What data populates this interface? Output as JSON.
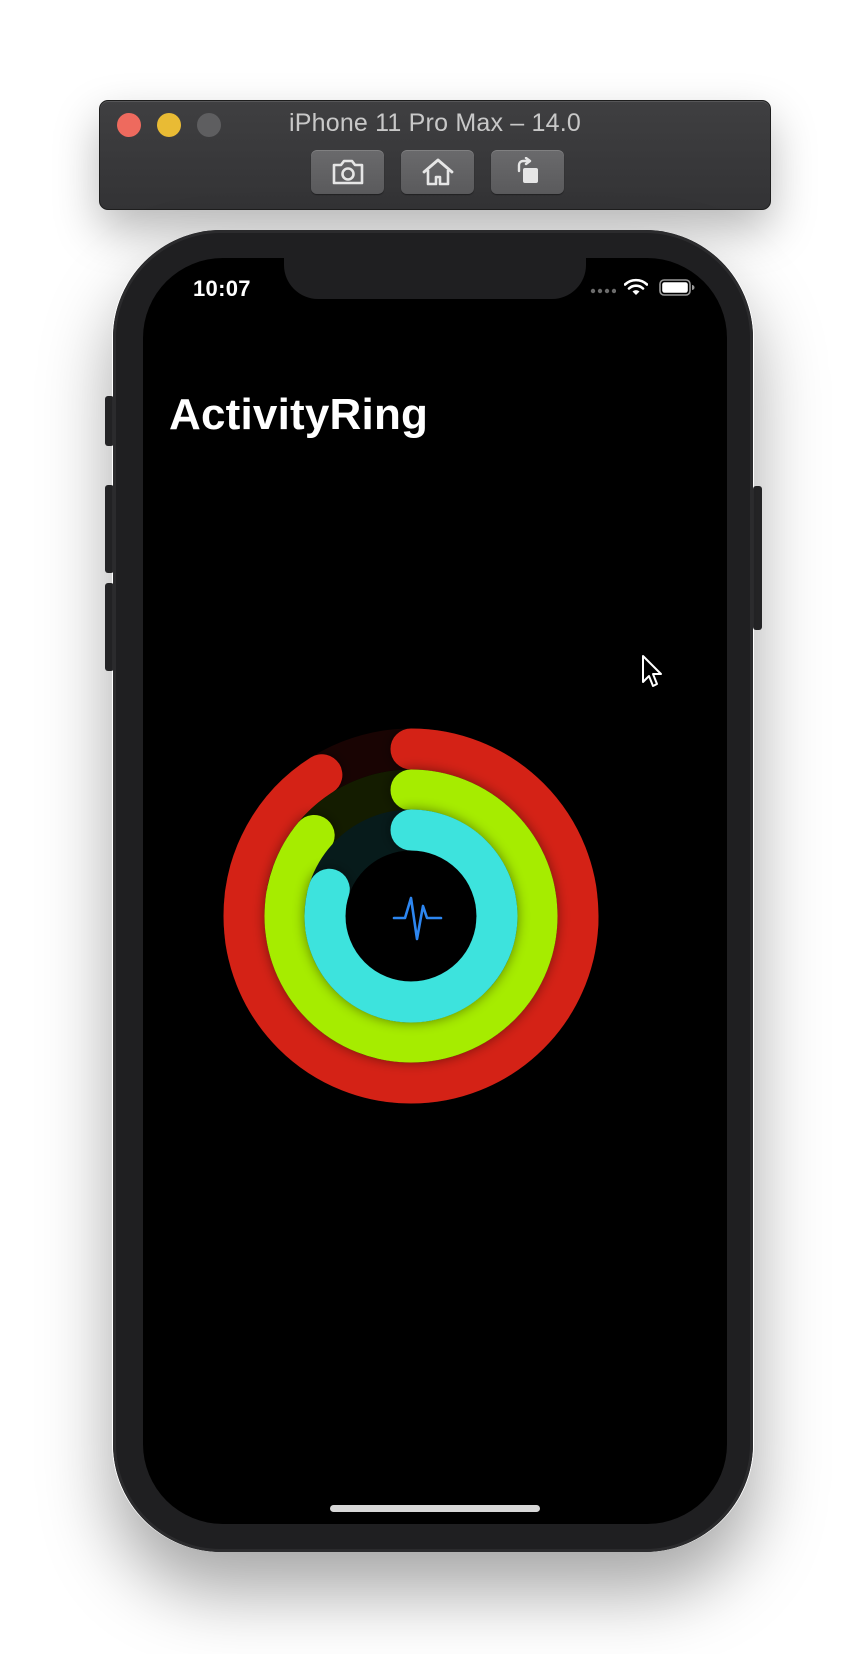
{
  "simulator": {
    "title": "iPhone 11 Pro Max – 14.0",
    "toolbar": [
      {
        "label": "Screenshot",
        "icon": "camera-icon"
      },
      {
        "label": "Home",
        "icon": "home-icon"
      },
      {
        "label": "Rotate",
        "icon": "rotate-icon"
      }
    ]
  },
  "status_bar": {
    "time": "10:07",
    "icons": [
      "cellular-signal-icon",
      "wifi-icon",
      "battery-icon"
    ]
  },
  "app": {
    "title": "ActivityRing",
    "center_icon": "heartbeat-icon",
    "rings": [
      {
        "name": "outer",
        "color": "#d42419",
        "progress": 0.91
      },
      {
        "name": "middle",
        "color": "#a6ec00",
        "progress": 0.86
      },
      {
        "name": "inner",
        "color": "#3ee3dd",
        "progress": 0.8
      }
    ]
  },
  "colors": {
    "screen_bg": "#000000",
    "heartbeat": "#2d86f0"
  }
}
